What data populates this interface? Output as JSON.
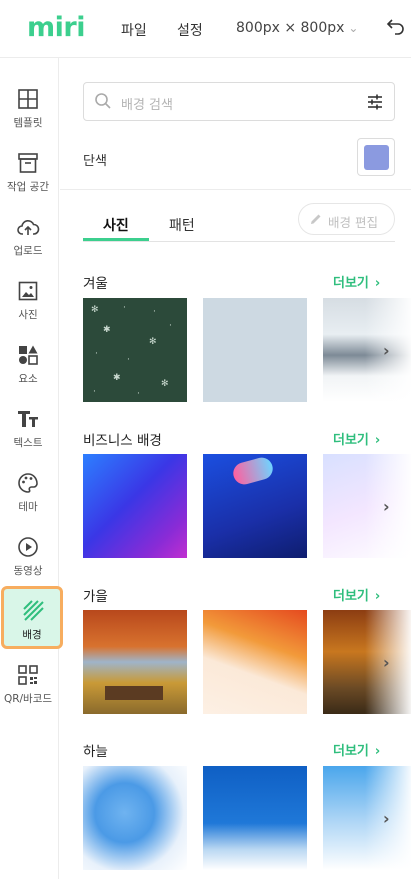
{
  "header": {
    "logo": "miri",
    "menu": [
      "파일",
      "설정"
    ],
    "canvas_size": "800px × 800px",
    "size_chevron_icon": "chevron-down-icon",
    "undo_icon": "undo-icon"
  },
  "sidebar": {
    "items": [
      {
        "label": "템플릿",
        "icon": "layout-icon"
      },
      {
        "label": "작업 공간",
        "icon": "archive-icon"
      },
      {
        "label": "업로드",
        "icon": "cloud-upload-icon"
      },
      {
        "label": "사진",
        "icon": "image-icon"
      },
      {
        "label": "요소",
        "icon": "shapes-icon"
      },
      {
        "label": "텍스트",
        "icon": "text-icon"
      },
      {
        "label": "테마",
        "icon": "palette-icon"
      },
      {
        "label": "동영상",
        "icon": "play-circle-icon"
      },
      {
        "label": "배경",
        "icon": "background-hatch-icon",
        "active": true
      },
      {
        "label": "QR/바코드",
        "icon": "qr-code-icon"
      }
    ],
    "active_color": "#d9f6e8",
    "highlight_color": "#f7ad5f"
  },
  "panel": {
    "search_placeholder": "배경 검색",
    "solid_label": "단색",
    "solid_color": "#8b9ae0",
    "tabs": [
      "사진",
      "패턴"
    ],
    "active_tab": "사진",
    "edit_button": "배경 편집",
    "more_label": "더보기",
    "sections": [
      {
        "title": "겨울"
      },
      {
        "title": "비즈니스 배경"
      },
      {
        "title": "가을"
      },
      {
        "title": "하늘"
      }
    ]
  },
  "colors": {
    "accent": "#3ccf8e",
    "more_text": "#2fbe7d"
  }
}
